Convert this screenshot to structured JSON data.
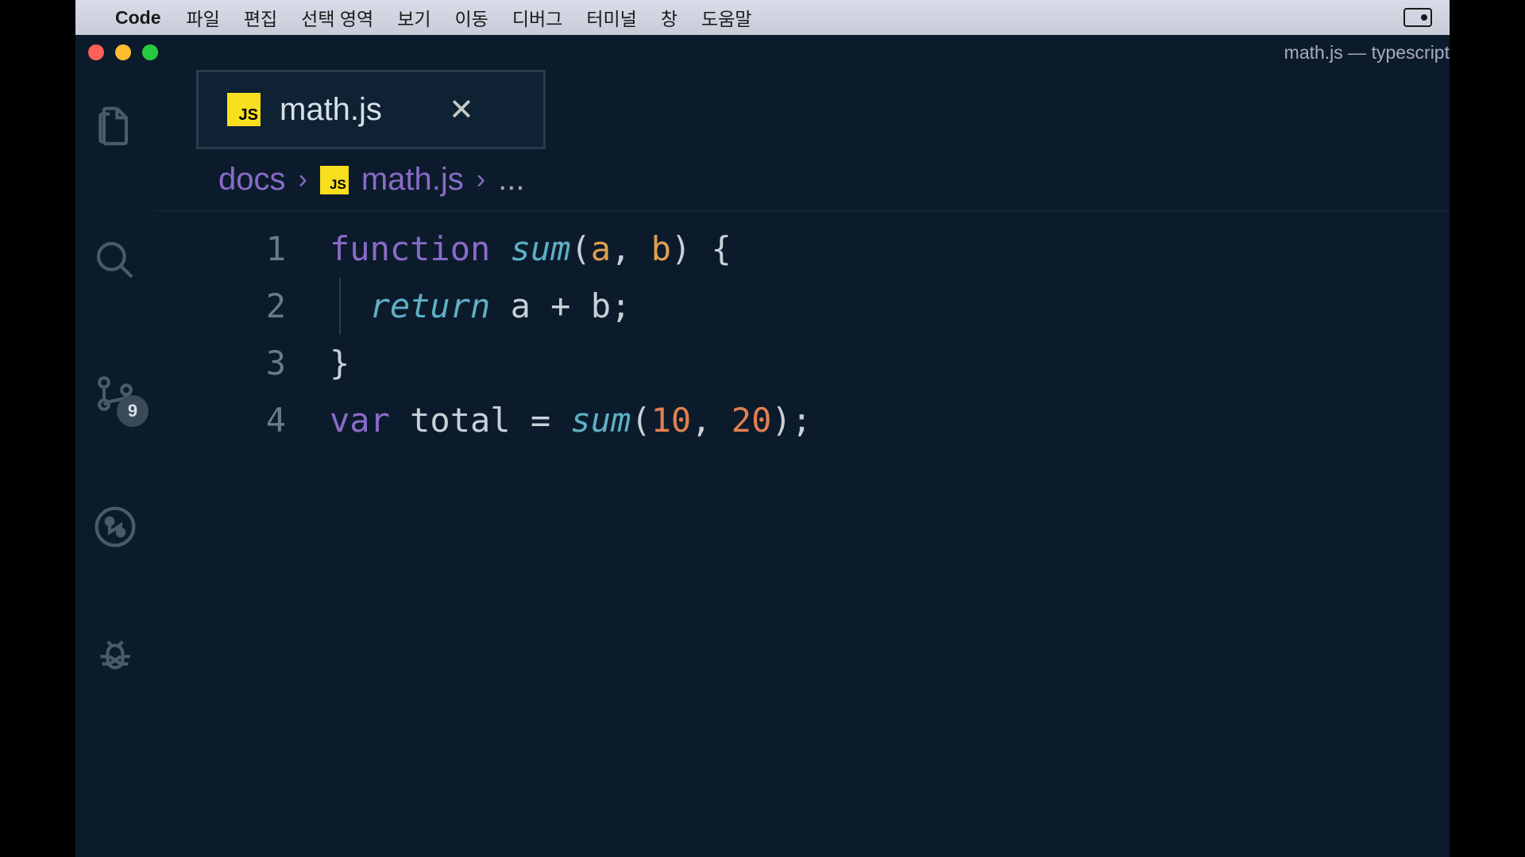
{
  "menubar": {
    "app": "Code",
    "items": [
      "파일",
      "편집",
      "선택 영역",
      "보기",
      "이동",
      "디버그",
      "터미널",
      "창",
      "도움말"
    ]
  },
  "window": {
    "title": "math.js — typescript"
  },
  "activity": {
    "scm_badge": "9"
  },
  "tab": {
    "icon_label": "JS",
    "label": "math.js"
  },
  "breadcrumb": {
    "segments": [
      "docs",
      "math.js"
    ],
    "icon_label": "JS",
    "ellipsis": "..."
  },
  "code": {
    "line_numbers": [
      "1",
      "2",
      "3",
      "4"
    ],
    "lines": {
      "l1": {
        "kw_function": "function",
        "fn_name": "sum",
        "paren_open": "(",
        "param_a": "a",
        "comma1": ", ",
        "param_b": "b",
        "paren_close": ")",
        "brace_open": " {"
      },
      "l2": {
        "kw_return": "return",
        "var_a": " a ",
        "op_plus": "+",
        "var_b": " b",
        "semi": ";"
      },
      "l3": {
        "brace_close": "}"
      },
      "l4": {
        "kw_var": "var",
        "var_total": " total ",
        "op_eq": "=",
        "sp": " ",
        "fn_sum": "sum",
        "paren_open": "(",
        "num_10": "10",
        "comma": ", ",
        "num_20": "20",
        "paren_close": ")",
        "semi": ";"
      }
    }
  }
}
